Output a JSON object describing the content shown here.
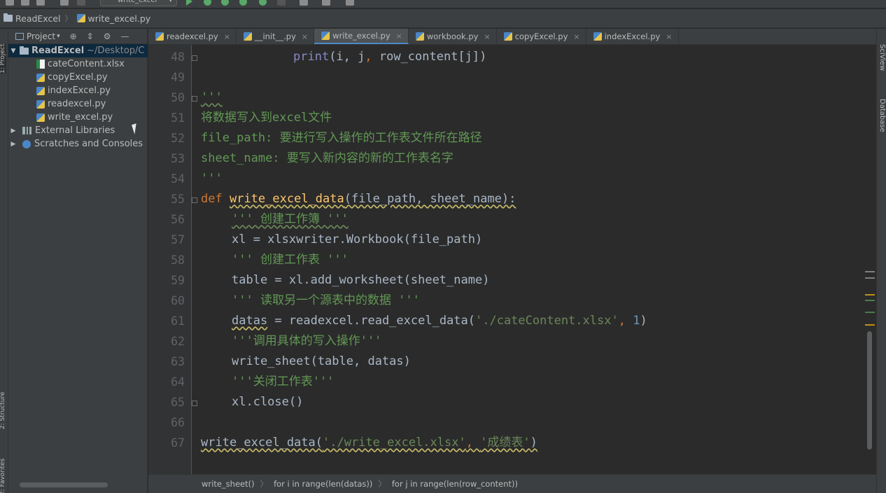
{
  "toolbar": {
    "run_config": "write_excel"
  },
  "navbar": {
    "project": "ReadExcel",
    "file": "write_excel.py"
  },
  "left_strip": {
    "project_label": "1: Project",
    "structure_label": "2: Structure",
    "favorites_label": "2: Favorites"
  },
  "right_strip": {
    "sciview_label": "SciView",
    "database_label": "Database"
  },
  "project_panel": {
    "title": "Project",
    "root_name": "ReadExcel",
    "root_path": "~/Desktop/C",
    "files": [
      "cateContent.xlsx",
      "copyExcel.py",
      "indexExcel.py",
      "readexcel.py",
      "write_excel.py"
    ],
    "external_libraries": "External Libraries",
    "scratches": "Scratches and Consoles"
  },
  "tabs": [
    {
      "label": "readexcel.py",
      "active": false
    },
    {
      "label": "__init__.py",
      "active": false
    },
    {
      "label": "write_excel.py",
      "active": true
    },
    {
      "label": "workbook.py",
      "active": false
    },
    {
      "label": "copyExcel.py",
      "active": false
    },
    {
      "label": "indexExcel.py",
      "active": false
    }
  ],
  "editor": {
    "line_numbers": [
      "48",
      "49",
      "50",
      "51",
      "52",
      "53",
      "54",
      "55",
      "56",
      "57",
      "58",
      "59",
      "60",
      "61",
      "62",
      "63",
      "64",
      "65",
      "66",
      "67"
    ],
    "lines": {
      "l48": {
        "print": "print",
        "args_a": "(i, j",
        "comma": ",",
        "args_b": " row_content[j])"
      },
      "l50": "'''",
      "l51": "将数据写入到excel文件",
      "l52": "file_path: 要进行写入操作的工作表文件所在路径",
      "l53": "sheet_name: 要写入新内容的新的工作表名字",
      "l54": "'''",
      "l55": {
        "def": "def",
        "name": "write_excel_data",
        "params": "(file_path, sheet_name):"
      },
      "l56": "''' 创建工作簿 '''",
      "l57": "xl = xlsxwriter.Workbook(file_path)",
      "l58": "''' 创建工作表 '''",
      "l59": "table = xl.add_worksheet(sheet_name)",
      "l60": "''' 读取另一个源表中的数据 '''",
      "l61": {
        "lhs": "datas",
        "mid": " = readexcel.read_excel_data(",
        "str": "'./cateContent.xlsx'",
        "comma": ", ",
        "num": "1",
        "end": ")"
      },
      "l62": "'''调用具体的写入操作'''",
      "l63": "write_sheet(table, datas)",
      "l64": "'''关闭工作表'''",
      "l65": "xl.close()",
      "l67": {
        "call": "write_excel_data(",
        "s1": "'./write_excel.xlsx'",
        "comma": ", ",
        "s2": "'成绩表'",
        "end": ")"
      }
    }
  },
  "footer_breadcrumb": [
    "write_sheet()",
    "for i in range(len(datas))",
    "for j in range(len(row_content))"
  ]
}
